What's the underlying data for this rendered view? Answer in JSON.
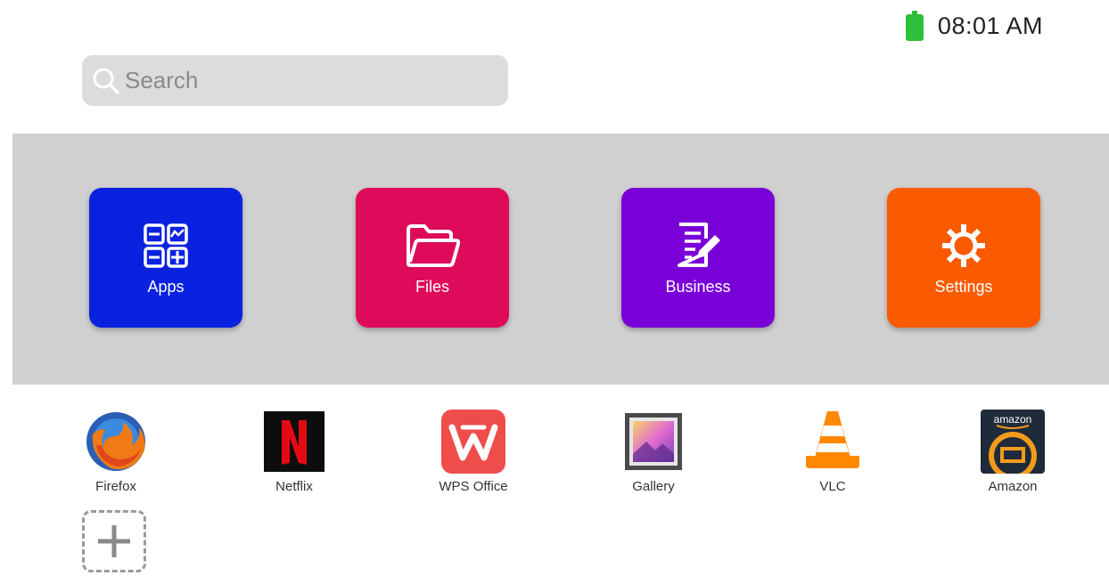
{
  "status": {
    "time": "08:01 AM",
    "battery_color": "#2fbf3a"
  },
  "search": {
    "placeholder": "Search",
    "icon": "search-icon"
  },
  "categories": [
    {
      "label": "Apps",
      "color": "#0a22e0",
      "icon": "apps-grid-icon"
    },
    {
      "label": "Files",
      "color": "#de0b5a",
      "icon": "folder-icon"
    },
    {
      "label": "Business",
      "color": "#7a00d8",
      "icon": "document-edit-icon"
    },
    {
      "label": "Settings",
      "color": "#fa5a00",
      "icon": "gear-icon"
    }
  ],
  "apps": [
    {
      "label": "Firefox",
      "icon": "firefox-icon"
    },
    {
      "label": "Netflix",
      "icon": "netflix-icon"
    },
    {
      "label": "WPS Office",
      "icon": "wps-office-icon"
    },
    {
      "label": "Gallery",
      "icon": "gallery-icon"
    },
    {
      "label": "VLC",
      "icon": "vlc-icon"
    },
    {
      "label": "Amazon",
      "icon": "amazon-icon",
      "logo_text": "amazon"
    }
  ],
  "add_button": {
    "icon": "plus-icon"
  }
}
